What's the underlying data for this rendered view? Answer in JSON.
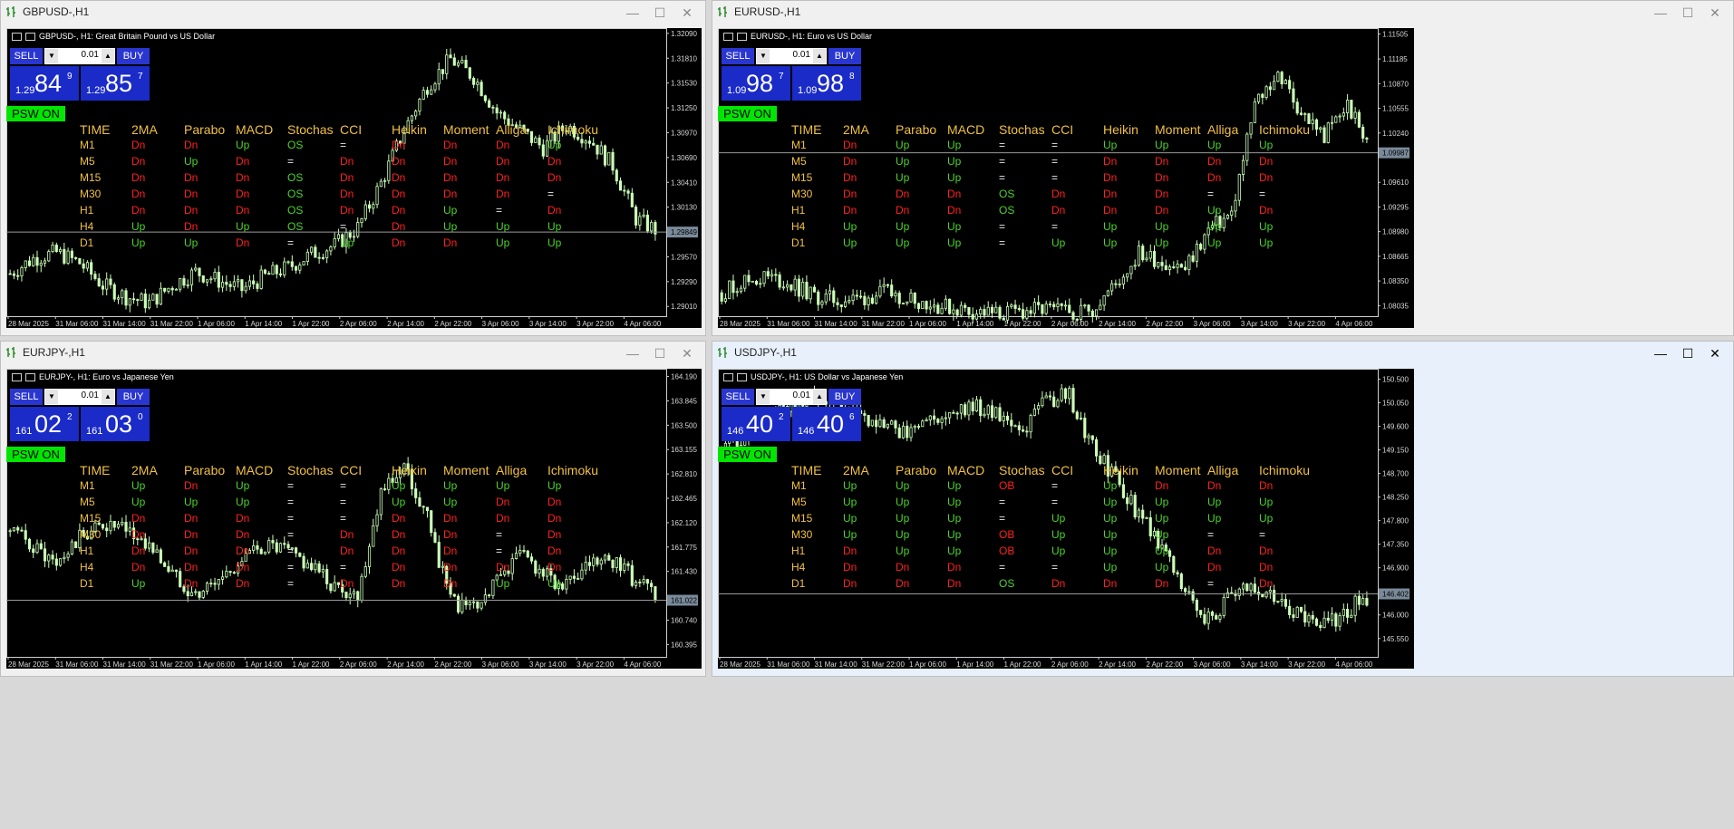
{
  "windows": [
    {
      "id": "gbpusd",
      "title": "GBPUSD-,H1",
      "info": "GBPUSD-, H1:  Great Britain Pound vs US Dollar",
      "lot": "0.01",
      "sell_label": "SELL",
      "buy_label": "BUY",
      "bid": {
        "prefix": "1.29",
        "big": "84",
        "pip": "9"
      },
      "ask": {
        "prefix": "1.29",
        "big": "85",
        "pip": "7"
      },
      "psw_label": "PSW ON",
      "price_labels": [
        "1.32090",
        "1.31810",
        "1.31530",
        "1.31250",
        "1.30970",
        "1.30690",
        "1.30410",
        "1.30130",
        "1.29849",
        "1.29570",
        "1.29290",
        "1.29010"
      ],
      "current_price": "1.29849",
      "chart_data": {
        "type": "candlestick",
        "x": [
          "28 Mar 2025",
          "31 Mar 06:00",
          "31 Mar 14:00",
          "31 Mar 22:00",
          "1 Apr 06:00",
          "1 Apr 14:00",
          "1 Apr 22:00",
          "2 Apr 06:00",
          "2 Apr 14:00",
          "2 Apr 22:00",
          "3 Apr 06:00",
          "3 Apr 14:00",
          "3 Apr 22:00",
          "4 Apr 06:00"
        ],
        "ylim": [
          1.289,
          1.3215
        ],
        "closes": [
          1.2938,
          1.2955,
          1.2962,
          1.295,
          1.2925,
          1.2912,
          1.2905,
          1.2925,
          1.294,
          1.293,
          1.292,
          1.2935,
          1.2945,
          1.296,
          1.297,
          1.299,
          1.304,
          1.31,
          1.315,
          1.318,
          1.316,
          1.312,
          1.31,
          1.308,
          1.3105,
          1.309,
          1.306,
          1.3,
          1.2985
        ]
      },
      "indicator_table": {
        "headers": [
          "TIME",
          "2MA",
          "Parabo",
          "MACD",
          "Stochas",
          "CCI",
          "Heikin",
          "Moment",
          "Alliga",
          "Ichimoku"
        ],
        "rows": [
          {
            "tf": "M1",
            "cells": [
              "Dn",
              "Dn",
              "Up",
              "OS",
              "=",
              "Dn",
              "Dn",
              "Dn",
              "Up"
            ]
          },
          {
            "tf": "M5",
            "cells": [
              "Dn",
              "Up",
              "Dn",
              "=",
              "Dn",
              "Dn",
              "Dn",
              "Dn",
              "Dn"
            ]
          },
          {
            "tf": "M15",
            "cells": [
              "Dn",
              "Dn",
              "Dn",
              "OS",
              "Dn",
              "Dn",
              "Dn",
              "Dn",
              "Dn"
            ]
          },
          {
            "tf": "M30",
            "cells": [
              "Dn",
              "Dn",
              "Dn",
              "OS",
              "Dn",
              "Dn",
              "Dn",
              "Dn",
              "="
            ]
          },
          {
            "tf": "H1",
            "cells": [
              "Dn",
              "Dn",
              "Dn",
              "OS",
              "Dn",
              "Dn",
              "Up",
              "=",
              "Dn"
            ]
          },
          {
            "tf": "H4",
            "cells": [
              "Up",
              "Dn",
              "Up",
              "OS",
              "=",
              "Dn",
              "Up",
              "Up",
              "Up"
            ]
          },
          {
            "tf": "D1",
            "cells": [
              "Up",
              "Up",
              "Dn",
              "=",
              "Up",
              "Dn",
              "Dn",
              "Up",
              "Up"
            ]
          }
        ]
      }
    },
    {
      "id": "eurusd",
      "title": "EURUSD-,H1",
      "info": "EURUSD-, H1:  Euro vs US Dollar",
      "lot": "0.01",
      "sell_label": "SELL",
      "buy_label": "BUY",
      "bid": {
        "prefix": "1.09",
        "big": "98",
        "pip": "7"
      },
      "ask": {
        "prefix": "1.09",
        "big": "98",
        "pip": "8"
      },
      "psw_label": "PSW ON",
      "price_labels": [
        "1.11505",
        "1.11185",
        "1.10870",
        "1.10555",
        "1.10240",
        "1.09987",
        "1.09610",
        "1.09295",
        "1.08980",
        "1.08665",
        "1.08350",
        "1.08035"
      ],
      "current_price": "1.09987",
      "chart_data": {
        "type": "candlestick",
        "x": [
          "28 Mar 2025",
          "31 Mar 06:00",
          "31 Mar 14:00",
          "31 Mar 22:00",
          "1 Apr 06:00",
          "1 Apr 14:00",
          "1 Apr 22:00",
          "2 Apr 06:00",
          "2 Apr 14:00",
          "2 Apr 22:00",
          "3 Apr 06:00",
          "3 Apr 14:00",
          "3 Apr 22:00",
          "4 Apr 06:00"
        ],
        "ylim": [
          1.079,
          1.1158
        ],
        "closes": [
          1.082,
          1.0835,
          1.084,
          1.083,
          1.0815,
          1.081,
          1.0812,
          1.082,
          1.0815,
          1.0805,
          1.08,
          1.0795,
          1.0792,
          1.0796,
          1.0798,
          1.0795,
          1.08,
          1.083,
          1.087,
          1.086,
          1.085,
          1.09,
          1.092,
          1.106,
          1.11,
          1.105,
          1.102,
          1.106,
          1.1
        ]
      },
      "indicator_table": {
        "headers": [
          "TIME",
          "2MA",
          "Parabo",
          "MACD",
          "Stochas",
          "CCI",
          "Heikin",
          "Moment",
          "Alliga",
          "Ichimoku"
        ],
        "rows": [
          {
            "tf": "M1",
            "cells": [
              "Dn",
              "Up",
              "Up",
              "=",
              "=",
              "Up",
              "Up",
              "Up",
              "Up"
            ]
          },
          {
            "tf": "M5",
            "cells": [
              "Dn",
              "Up",
              "Up",
              "=",
              "=",
              "Dn",
              "Dn",
              "Dn",
              "Dn"
            ]
          },
          {
            "tf": "M15",
            "cells": [
              "Dn",
              "Up",
              "Up",
              "=",
              "=",
              "Dn",
              "Dn",
              "Dn",
              "Dn"
            ]
          },
          {
            "tf": "M30",
            "cells": [
              "Dn",
              "Dn",
              "Dn",
              "OS",
              "Dn",
              "Dn",
              "Dn",
              "=",
              "="
            ]
          },
          {
            "tf": "H1",
            "cells": [
              "Dn",
              "Dn",
              "Dn",
              "OS",
              "Dn",
              "Dn",
              "Dn",
              "Up",
              "Dn"
            ]
          },
          {
            "tf": "H4",
            "cells": [
              "Up",
              "Up",
              "Up",
              "=",
              "=",
              "Up",
              "Up",
              "Up",
              "Up"
            ]
          },
          {
            "tf": "D1",
            "cells": [
              "Up",
              "Up",
              "Up",
              "=",
              "Up",
              "Up",
              "Up",
              "Up",
              "Up"
            ]
          }
        ]
      }
    },
    {
      "id": "eurjpy",
      "title": "EURJPY-,H1",
      "info": "EURJPY-, H1:  Euro vs Japanese Yen",
      "lot": "0.01",
      "sell_label": "SELL",
      "buy_label": "BUY",
      "bid": {
        "prefix": "161",
        "big": "02",
        "pip": "2"
      },
      "ask": {
        "prefix": "161",
        "big": "03",
        "pip": "0"
      },
      "psw_label": "PSW ON",
      "price_labels": [
        "164.190",
        "163.845",
        "163.500",
        "163.155",
        "162.810",
        "162.465",
        "162.120",
        "161.775",
        "161.430",
        "161.022",
        "160.740",
        "160.395"
      ],
      "current_price": "161.022",
      "chart_data": {
        "type": "candlestick",
        "x": [
          "28 Mar 2025",
          "31 Mar 06:00",
          "31 Mar 14:00",
          "31 Mar 22:00",
          "1 Apr 06:00",
          "1 Apr 14:00",
          "1 Apr 22:00",
          "2 Apr 06:00",
          "2 Apr 14:00",
          "2 Apr 22:00",
          "3 Apr 06:00",
          "3 Apr 14:00",
          "3 Apr 22:00",
          "4 Apr 06:00"
        ],
        "ylim": [
          160.22,
          164.3
        ],
        "closes": [
          162.0,
          161.8,
          161.5,
          161.9,
          162.1,
          162.0,
          161.8,
          161.4,
          161.1,
          161.3,
          161.6,
          161.8,
          161.7,
          161.5,
          161.2,
          161.1,
          162.6,
          162.9,
          162.2,
          161.0,
          160.9,
          161.3,
          161.7,
          161.4,
          161.2,
          161.5,
          161.6,
          161.3,
          161.0
        ]
      },
      "indicator_table": {
        "headers": [
          "TIME",
          "2MA",
          "Parabo",
          "MACD",
          "Stochas",
          "CCI",
          "Heikin",
          "Moment",
          "Alliga",
          "Ichimoku"
        ],
        "rows": [
          {
            "tf": "M1",
            "cells": [
              "Up",
              "Dn",
              "Up",
              "=",
              "=",
              "Up",
              "Up",
              "Up",
              "Up"
            ]
          },
          {
            "tf": "M5",
            "cells": [
              "Up",
              "Up",
              "Up",
              "=",
              "=",
              "Up",
              "Up",
              "Dn",
              "Dn"
            ]
          },
          {
            "tf": "M15",
            "cells": [
              "Dn",
              "Dn",
              "Dn",
              "=",
              "=",
              "Dn",
              "Dn",
              "Dn",
              "Dn"
            ]
          },
          {
            "tf": "M30",
            "cells": [
              "Dn",
              "Dn",
              "Dn",
              "=",
              "Dn",
              "Dn",
              "Dn",
              "=",
              "Dn"
            ]
          },
          {
            "tf": "H1",
            "cells": [
              "Dn",
              "Dn",
              "Dn",
              "=",
              "Dn",
              "Dn",
              "Dn",
              "=",
              "Dn"
            ]
          },
          {
            "tf": "H4",
            "cells": [
              "Dn",
              "Dn",
              "Dn",
              "=",
              "=",
              "Dn",
              "Dn",
              "Dn",
              "Dn"
            ]
          },
          {
            "tf": "D1",
            "cells": [
              "Up",
              "Dn",
              "Dn",
              "=",
              "Dn",
              "Dn",
              "Dn",
              "Up",
              "Up"
            ]
          }
        ]
      }
    },
    {
      "id": "usdjpy",
      "title": "USDJPY-,H1",
      "info": "USDJPY-, H1:  US Dollar vs Japanese Yen",
      "lot": "0.01",
      "sell_label": "SELL",
      "buy_label": "BUY",
      "bid": {
        "prefix": "146",
        "big": "40",
        "pip": "2"
      },
      "ask": {
        "prefix": "146",
        "big": "40",
        "pip": "6"
      },
      "psw_label": "PSW ON",
      "price_labels": [
        "150.500",
        "150.050",
        "149.600",
        "149.150",
        "148.700",
        "148.250",
        "147.800",
        "147.350",
        "146.900",
        "146.402",
        "146.000",
        "145.550"
      ],
      "current_price": "146.402",
      "chart_data": {
        "type": "candlestick",
        "x": [
          "28 Mar 2025",
          "31 Mar 06:00",
          "31 Mar 14:00",
          "31 Mar 22:00",
          "1 Apr 06:00",
          "1 Apr 14:00",
          "1 Apr 22:00",
          "2 Apr 06:00",
          "2 Apr 14:00",
          "2 Apr 22:00",
          "3 Apr 06:00",
          "3 Apr 14:00",
          "3 Apr 22:00",
          "4 Apr 06:00"
        ],
        "ylim": [
          145.2,
          150.7
        ],
        "closes": [
          149.2,
          149.4,
          149.8,
          150.1,
          150.2,
          150.0,
          149.8,
          149.6,
          149.5,
          149.7,
          149.9,
          150.0,
          149.8,
          149.5,
          150.1,
          150.2,
          149.2,
          148.6,
          147.9,
          147.3,
          146.5,
          145.9,
          146.4,
          146.6,
          146.3,
          146.0,
          145.8,
          146.1,
          146.4
        ]
      },
      "indicator_table": {
        "headers": [
          "TIME",
          "2MA",
          "Parabo",
          "MACD",
          "Stochas",
          "CCI",
          "Heikin",
          "Moment",
          "Alliga",
          "Ichimoku"
        ],
        "rows": [
          {
            "tf": "M1",
            "cells": [
              "Up",
              "Up",
              "Up",
              "OB",
              "=",
              "Up",
              "Dn",
              "Dn",
              "Dn"
            ]
          },
          {
            "tf": "M5",
            "cells": [
              "Up",
              "Up",
              "Up",
              "=",
              "=",
              "Up",
              "Up",
              "Up",
              "Up"
            ]
          },
          {
            "tf": "M15",
            "cells": [
              "Up",
              "Up",
              "Up",
              "=",
              "Up",
              "Up",
              "Up",
              "Up",
              "Up"
            ]
          },
          {
            "tf": "M30",
            "cells": [
              "Up",
              "Up",
              "Up",
              "OB",
              "Up",
              "Up",
              "Up",
              "=",
              "="
            ]
          },
          {
            "tf": "H1",
            "cells": [
              "Dn",
              "Up",
              "Up",
              "OB",
              "Up",
              "Up",
              "Up",
              "Dn",
              "Dn"
            ]
          },
          {
            "tf": "H4",
            "cells": [
              "Dn",
              "Dn",
              "Dn",
              "=",
              "=",
              "Up",
              "Up",
              "Dn",
              "Dn"
            ]
          },
          {
            "tf": "D1",
            "cells": [
              "Dn",
              "Dn",
              "Dn",
              "OS",
              "Dn",
              "Dn",
              "Dn",
              "=",
              "Dn"
            ]
          }
        ]
      }
    }
  ],
  "window_controls": {
    "minimize": "—",
    "maximize": "☐",
    "close": "✕"
  },
  "colors": {
    "background": "#000000",
    "candle_up": "#ccffb8",
    "up_text": "#4cd32b",
    "dn_text": "#ff2020",
    "header_text": "#f0c040",
    "trade_panel": "#1a2bc8",
    "psw": "#00e600"
  }
}
